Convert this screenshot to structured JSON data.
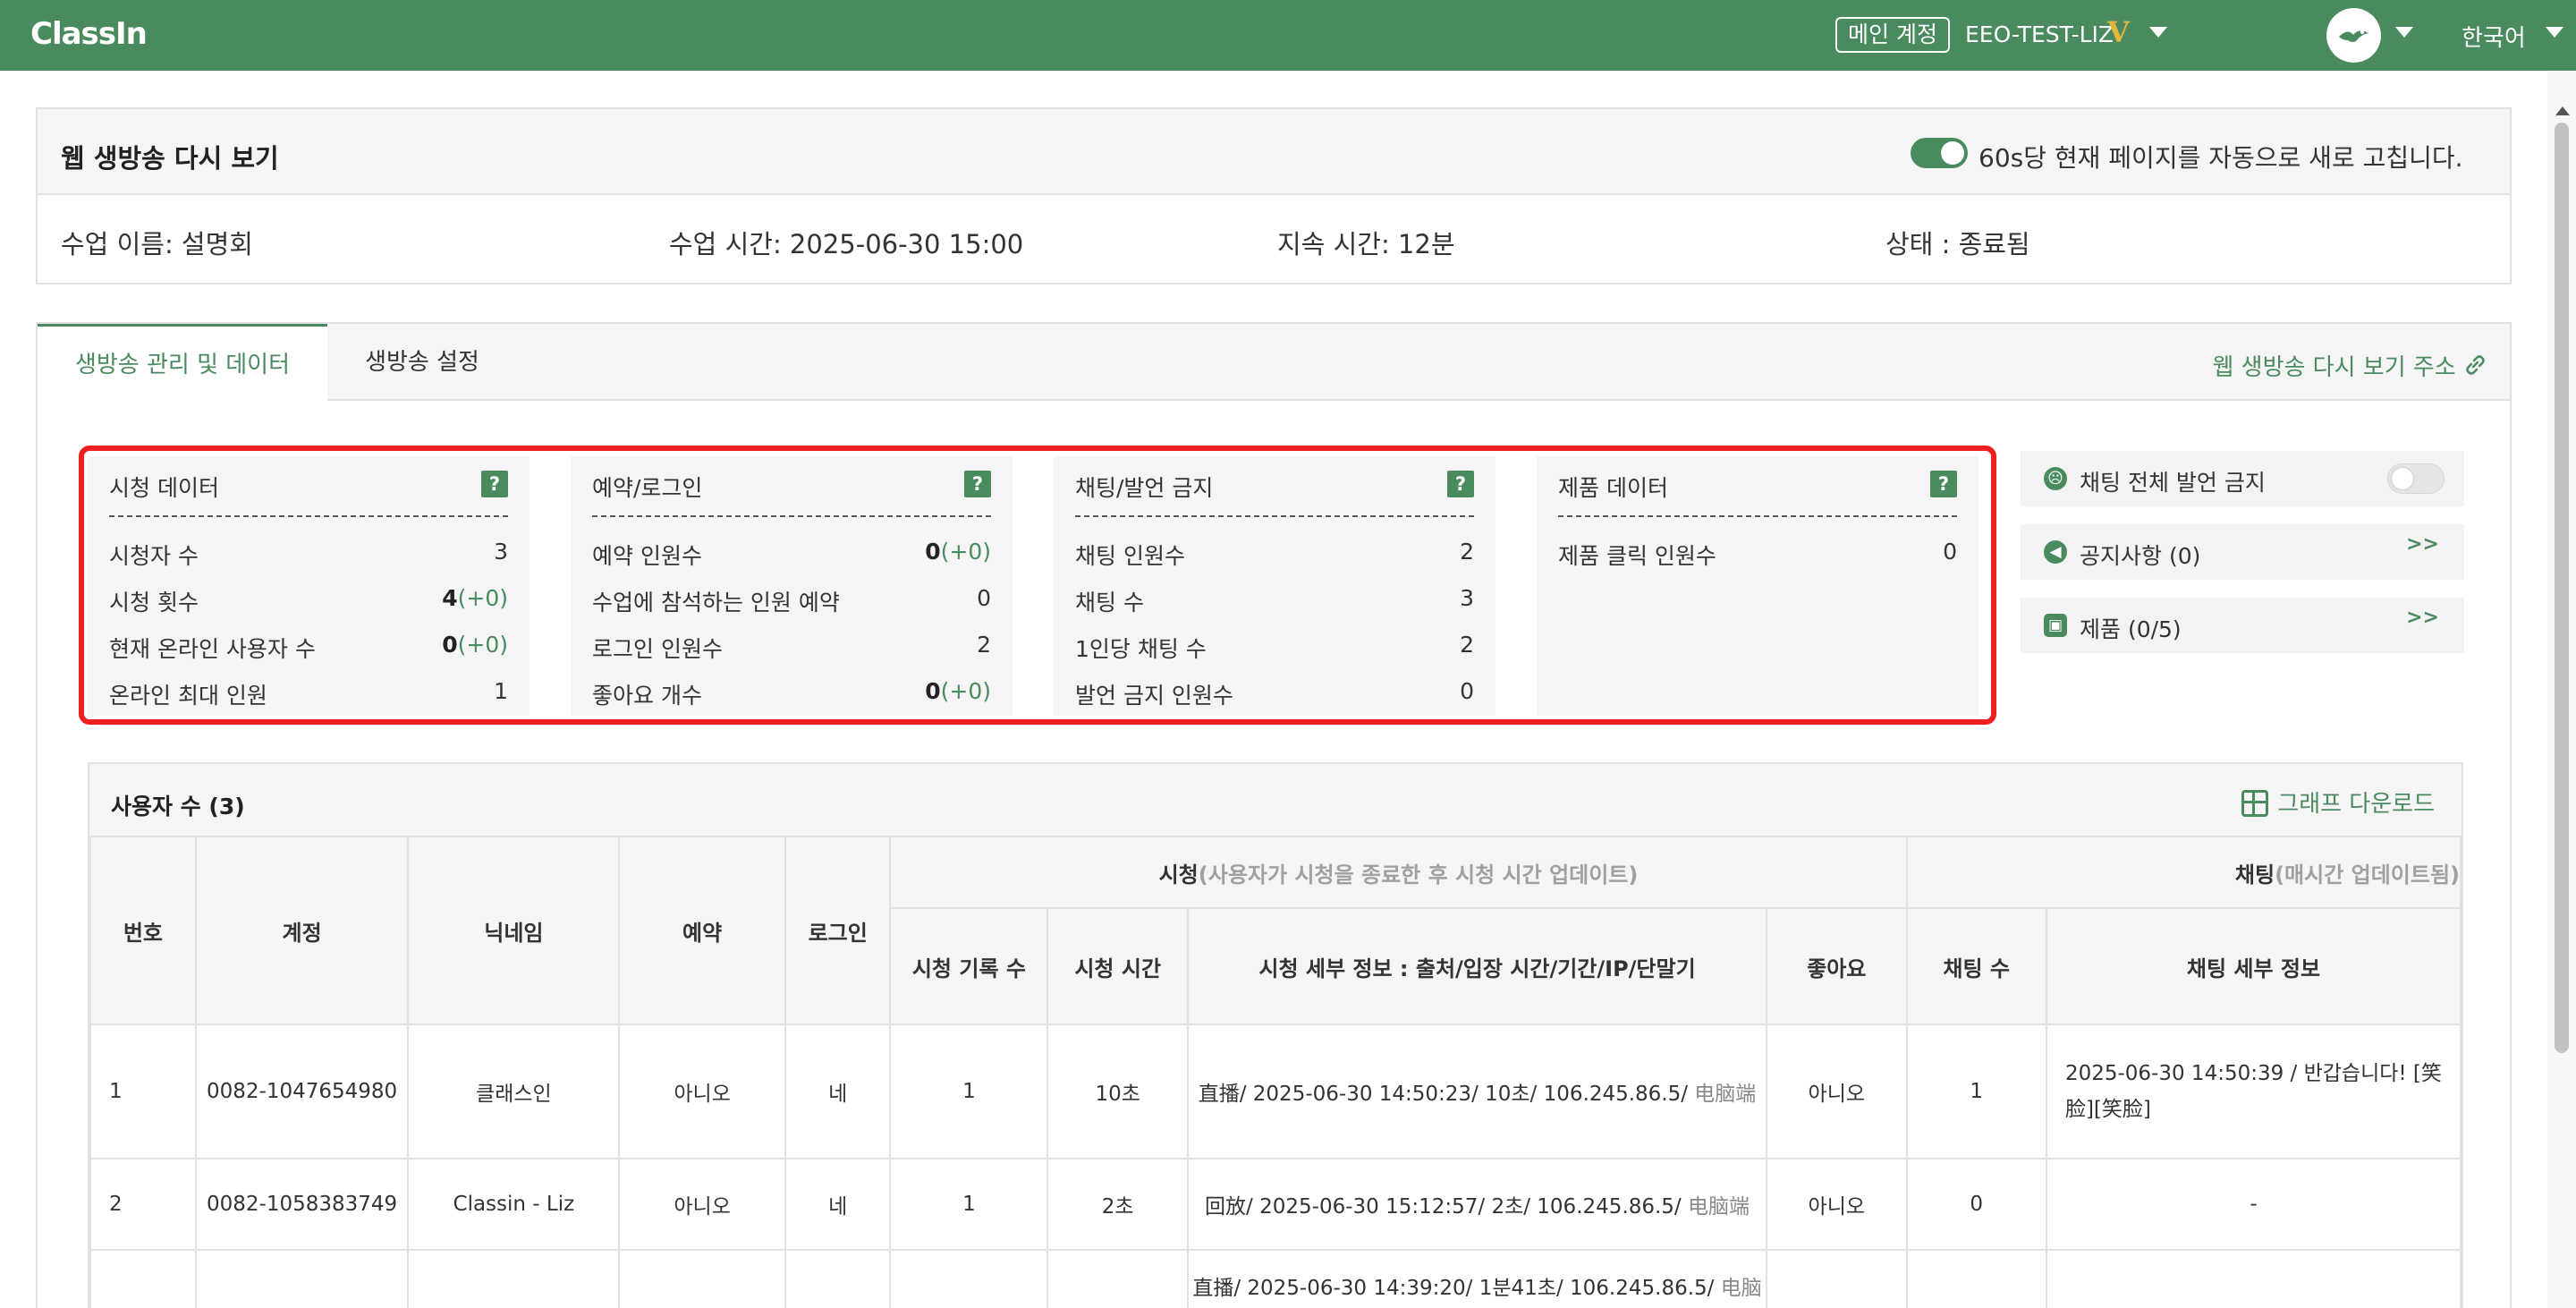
{
  "topbar": {
    "logo": "ClassIn",
    "account_badge": "메인 계정",
    "username": "EEO-TEST-LIZ",
    "vip_mark": "V",
    "language": "한국어"
  },
  "header": {
    "title": "웹 생방송 다시 보기",
    "auto_refresh": "60s당 현재 페이지를 자동으로 새로 고칩니다."
  },
  "info": {
    "class_name": "수업 이름: 설명회",
    "class_time": "수업 시간: 2025-06-30 15:00",
    "duration": "지속 시간: 12분",
    "status": "상태 : 종료됨"
  },
  "tabs": [
    {
      "label": "생방송 관리 및 데이터"
    },
    {
      "label": "생방송 설정"
    }
  ],
  "replay_link": "웹 생방송 다시 보기 주소",
  "cards": [
    {
      "title": "시청 데이터",
      "rows": [
        {
          "label": "시청자 수",
          "value": "3",
          "delta": ""
        },
        {
          "label": "시청 횟수",
          "value": "4",
          "delta": "(+0)"
        },
        {
          "label": "현재 온라인 사용자 수",
          "value": "0",
          "delta": "(+0)"
        },
        {
          "label": "온라인 최대 인원",
          "value": "1",
          "delta": ""
        }
      ]
    },
    {
      "title": "예약/로그인",
      "rows": [
        {
          "label": "예약 인원수",
          "value": "0",
          "delta": "(+0)"
        },
        {
          "label": "수업에 참석하는 인원 예약",
          "value": "0",
          "delta": ""
        },
        {
          "label": "로그인 인원수",
          "value": "2",
          "delta": ""
        },
        {
          "label": "좋아요 개수",
          "value": "0",
          "delta": "(+0)"
        }
      ]
    },
    {
      "title": "채팅/발언 금지",
      "rows": [
        {
          "label": "채팅 인원수",
          "value": "2",
          "delta": ""
        },
        {
          "label": "채팅 수",
          "value": "3",
          "delta": ""
        },
        {
          "label": "1인당 채팅 수",
          "value": "2",
          "delta": ""
        },
        {
          "label": "발언 금지 인원수",
          "value": "0",
          "delta": ""
        }
      ]
    },
    {
      "title": "제품 데이터",
      "rows": [
        {
          "label": "제품 클릭 인원수",
          "value": "0",
          "delta": ""
        }
      ]
    }
  ],
  "side_panel": {
    "mute_all": "채팅 전체 발언 금지",
    "notice": "공지사항 (0)",
    "products": "제품 (0/5)",
    "more": ">>"
  },
  "users": {
    "title": "사용자 수 (3)",
    "download": "그래프 다운로드",
    "headers": {
      "no": "번호",
      "account": "계정",
      "nickname": "닉네임",
      "reserve": "예약",
      "login": "로그인",
      "watch_group": "시청",
      "watch_group_note": "(사용자가 시청을 종료한 후 시청 시간 업데이트)",
      "chat_group": "채팅",
      "chat_group_note": "(매시간 업데이트됨)",
      "watch_count": "시청 기록 수",
      "watch_time": "시청 시간",
      "watch_detail": "시청 세부 정보 : 출처/입장 시간/기간/IP/단말기",
      "likes": "좋아요",
      "chat_count": "채팅 수",
      "chat_detail": "채팅 세부 정보"
    },
    "rows": [
      {
        "no": "1",
        "account": "0082-1047654980",
        "nickname": "클래스인",
        "reserve": "아니오",
        "login": "네",
        "watch_count": "1",
        "watch_time": "10초",
        "detail_main": "直播/ 2025-06-30 14:50:23/ 10초/ 106.245.86.5/",
        "detail_device": " 电脑端",
        "likes": "아니오",
        "chat_count": "1",
        "chat_line1": "2025-06-30 14:50:39 / 반갑습니다! [笑",
        "chat_line2": "脸][笑脸]"
      },
      {
        "no": "2",
        "account": "0082-1058383749",
        "nickname": "Classin - Liz",
        "reserve": "아니오",
        "login": "네",
        "watch_count": "1",
        "watch_time": "2초",
        "detail_main": "回放/ 2025-06-30 15:12:57/ 2초/ 106.245.86.5/",
        "detail_device": " 电脑端",
        "likes": "아니오",
        "chat_count": "0",
        "chat_line1": "-",
        "chat_line2": ""
      },
      {
        "no": "",
        "account": "",
        "nickname": "",
        "reserve": "",
        "login": "",
        "watch_count": "",
        "watch_time": "",
        "detail_main": "直播/ 2025-06-30 14:39:20/ 1분41초/ 106.245.86.5/",
        "detail_device": " 电脑",
        "likes": "",
        "chat_count": "",
        "chat_line1": "",
        "chat_line2": ""
      }
    ]
  }
}
